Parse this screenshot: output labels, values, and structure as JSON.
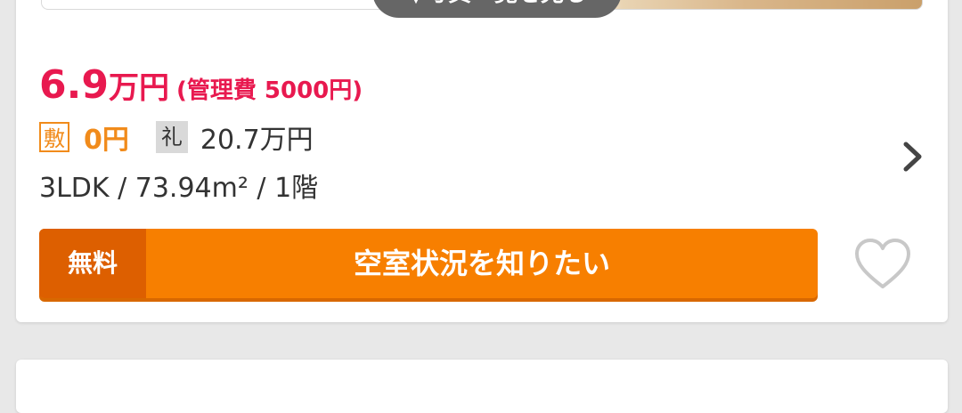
{
  "photo_button": {
    "label": "▼写真一覧を見る"
  },
  "rent": {
    "amount": "6.9",
    "unit": "万円",
    "management_fee": "(管理費 5000円)"
  },
  "deposit": {
    "badge": "敷",
    "value": "0円"
  },
  "key_money": {
    "badge": "礼",
    "value": "20.7万円"
  },
  "specs": {
    "text": "3LDK /  73.94m² /  1階"
  },
  "cta": {
    "free_label": "無料",
    "label": "空室状況を知りたい"
  },
  "icons": {
    "chevron": "chevron-right-icon",
    "favorite": "heart-icon"
  },
  "colors": {
    "price": "#e8194f",
    "accent": "#f77f00",
    "accent_dark": "#dd5f00",
    "deposit": "#f18b1b"
  }
}
